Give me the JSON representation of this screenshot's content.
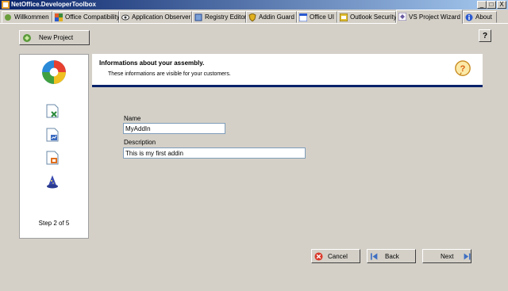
{
  "window": {
    "title": "NetOffice.DeveloperToolbox",
    "min": "_",
    "max": "□",
    "close": "X"
  },
  "tabs": [
    {
      "label": "Willkommen",
      "icon": "welcome-icon"
    },
    {
      "label": "Office Compatibility",
      "icon": "office-compatibility-icon"
    },
    {
      "label": "Application Observer",
      "icon": "eye-icon"
    },
    {
      "label": "Registry Editor",
      "icon": "registry-icon"
    },
    {
      "label": "Addin Guard",
      "icon": "guard-icon"
    },
    {
      "label": "Office UI",
      "icon": "office-ui-icon"
    },
    {
      "label": "Outlook Security",
      "icon": "outlook-security-icon"
    },
    {
      "label": "VS Project Wizard",
      "icon": "vs-wizard-icon"
    },
    {
      "label": "About",
      "icon": "about-icon"
    }
  ],
  "toolbar": {
    "new_project": "New Project",
    "help": "?"
  },
  "wizard": {
    "header_title": "Informations about your assembly.",
    "header_subtitle": "These informations are visible for your customers.",
    "step": "Step 2 of 5",
    "name_label": "Name",
    "name_value": "MyAddIn",
    "description_label": "Description",
    "description_value": "This is my first addin"
  },
  "buttons": {
    "cancel": "Cancel",
    "back": "Back",
    "next": "Next"
  },
  "colors": {
    "accent": "#0a246a",
    "cancel_red": "#d93a2b",
    "nav_blue": "#3e6fc2"
  }
}
